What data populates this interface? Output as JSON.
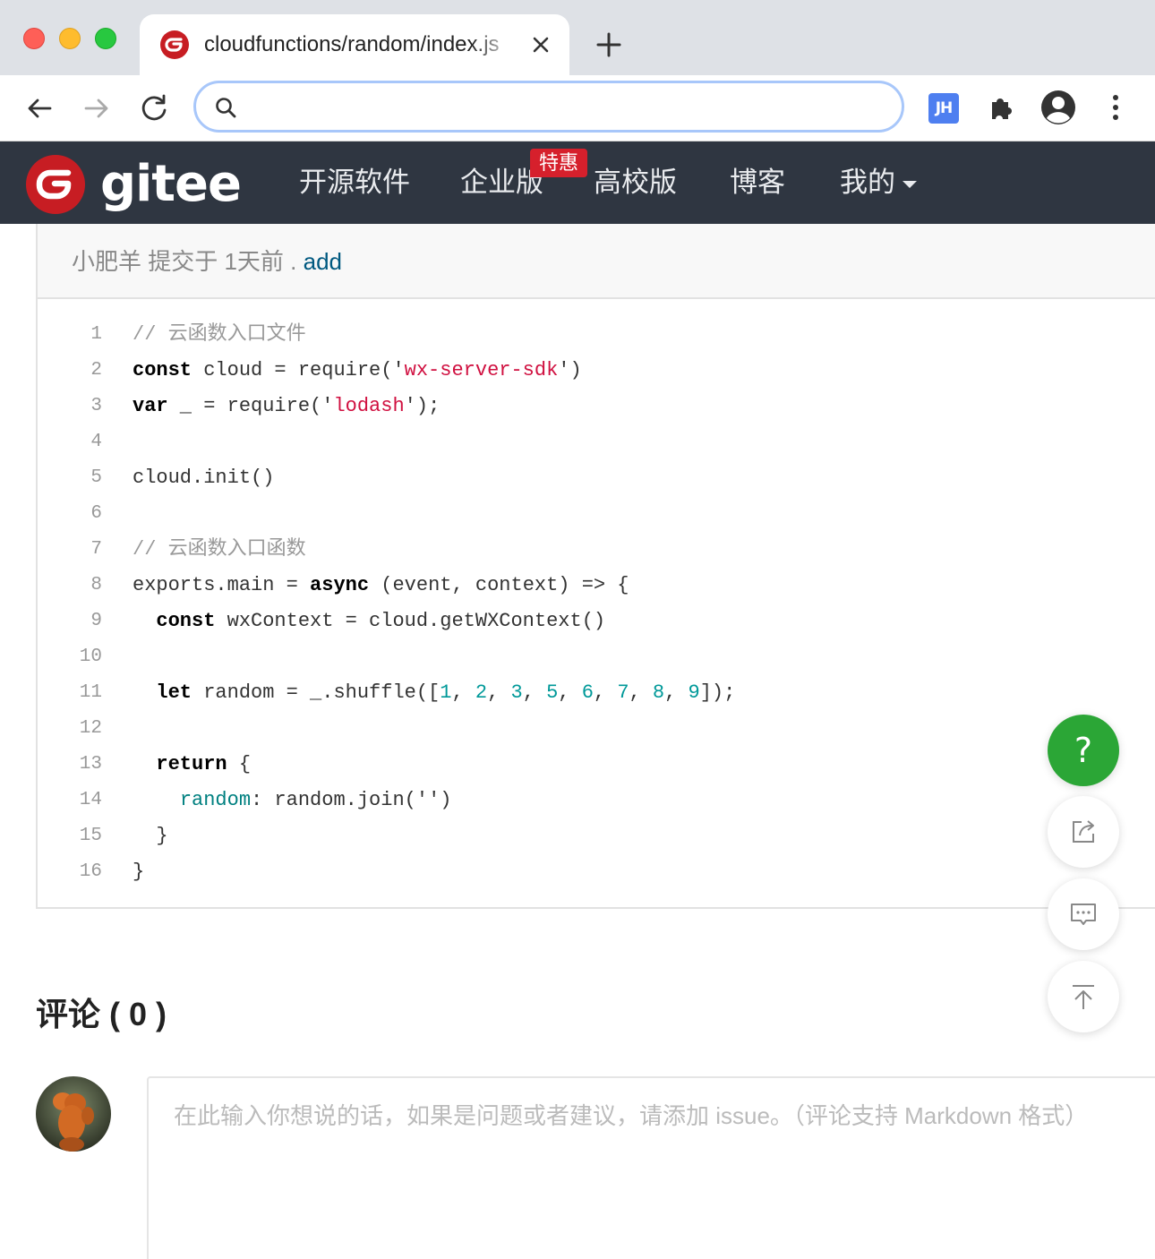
{
  "browser": {
    "tab_title": "cloudfunctions/random/index.js",
    "omnibox_placeholder": ""
  },
  "gitee": {
    "wordmark": "gitee",
    "nav": {
      "opensource": "开源软件",
      "enterprise": "企业版",
      "enterprise_badge": "特惠",
      "university": "高校版",
      "blog": "博客",
      "mine": "我的"
    }
  },
  "commit": {
    "author": "小肥羊",
    "time": "提交于 1天前",
    "separator": " . ",
    "message": "add"
  },
  "code": {
    "lines": [
      {
        "n": "1",
        "segs": [
          {
            "t": "// 云函数入口文件",
            "c": "com"
          }
        ]
      },
      {
        "n": "2",
        "segs": [
          {
            "t": "const",
            "c": "kw"
          },
          {
            "t": " cloud = require('",
            "c": ""
          },
          {
            "t": "wx-server-sdk",
            "c": "str"
          },
          {
            "t": "')",
            "c": ""
          }
        ]
      },
      {
        "n": "3",
        "segs": [
          {
            "t": "var",
            "c": "kw"
          },
          {
            "t": " _ = require('",
            "c": ""
          },
          {
            "t": "lodash",
            "c": "str"
          },
          {
            "t": "');",
            "c": ""
          }
        ]
      },
      {
        "n": "4",
        "segs": []
      },
      {
        "n": "5",
        "segs": [
          {
            "t": "cloud.init()",
            "c": ""
          }
        ]
      },
      {
        "n": "6",
        "segs": []
      },
      {
        "n": "7",
        "segs": [
          {
            "t": "// 云函数入口函数",
            "c": "com"
          }
        ]
      },
      {
        "n": "8",
        "segs": [
          {
            "t": "exports.main = ",
            "c": ""
          },
          {
            "t": "async",
            "c": "kw"
          },
          {
            "t": " (event, context) => {",
            "c": ""
          }
        ]
      },
      {
        "n": "9",
        "segs": [
          {
            "t": "  ",
            "c": ""
          },
          {
            "t": "const",
            "c": "kw"
          },
          {
            "t": " wxContext = cloud.getWXContext()",
            "c": ""
          }
        ]
      },
      {
        "n": "10",
        "segs": []
      },
      {
        "n": "11",
        "segs": [
          {
            "t": "  ",
            "c": ""
          },
          {
            "t": "let",
            "c": "kw"
          },
          {
            "t": " random = _.shuffle([",
            "c": ""
          },
          {
            "t": "1",
            "c": "num"
          },
          {
            "t": ", ",
            "c": ""
          },
          {
            "t": "2",
            "c": "num"
          },
          {
            "t": ", ",
            "c": ""
          },
          {
            "t": "3",
            "c": "num"
          },
          {
            "t": ", ",
            "c": ""
          },
          {
            "t": "5",
            "c": "num"
          },
          {
            "t": ", ",
            "c": ""
          },
          {
            "t": "6",
            "c": "num"
          },
          {
            "t": ", ",
            "c": ""
          },
          {
            "t": "7",
            "c": "num"
          },
          {
            "t": ", ",
            "c": ""
          },
          {
            "t": "8",
            "c": "num"
          },
          {
            "t": ", ",
            "c": ""
          },
          {
            "t": "9",
            "c": "num"
          },
          {
            "t": "]);",
            "c": ""
          }
        ]
      },
      {
        "n": "12",
        "segs": []
      },
      {
        "n": "13",
        "segs": [
          {
            "t": "  ",
            "c": ""
          },
          {
            "t": "return",
            "c": "kw"
          },
          {
            "t": " {",
            "c": ""
          }
        ]
      },
      {
        "n": "14",
        "segs": [
          {
            "t": "    ",
            "c": ""
          },
          {
            "t": "random",
            "c": "prop"
          },
          {
            "t": ": random.join('')",
            "c": ""
          }
        ]
      },
      {
        "n": "15",
        "segs": [
          {
            "t": "  }",
            "c": ""
          }
        ]
      },
      {
        "n": "16",
        "segs": [
          {
            "t": "}",
            "c": ""
          }
        ]
      }
    ]
  },
  "fab": {
    "help_label": "?",
    "icons": [
      "share-icon",
      "feedback-icon",
      "back-to-top-icon"
    ]
  },
  "comments": {
    "title": "评论 ( 0 )",
    "placeholder": "在此输入你想说的话，如果是问题或者建议，请添加 issue。（评论支持 Markdown 格式）"
  },
  "colors": {
    "header_bg": "#2f3641",
    "brand_red": "#c71d23",
    "badge_red": "#d6202c",
    "help_green": "#2ba636",
    "commit_link": "#005980",
    "string": "#d01040",
    "number": "#009999"
  }
}
